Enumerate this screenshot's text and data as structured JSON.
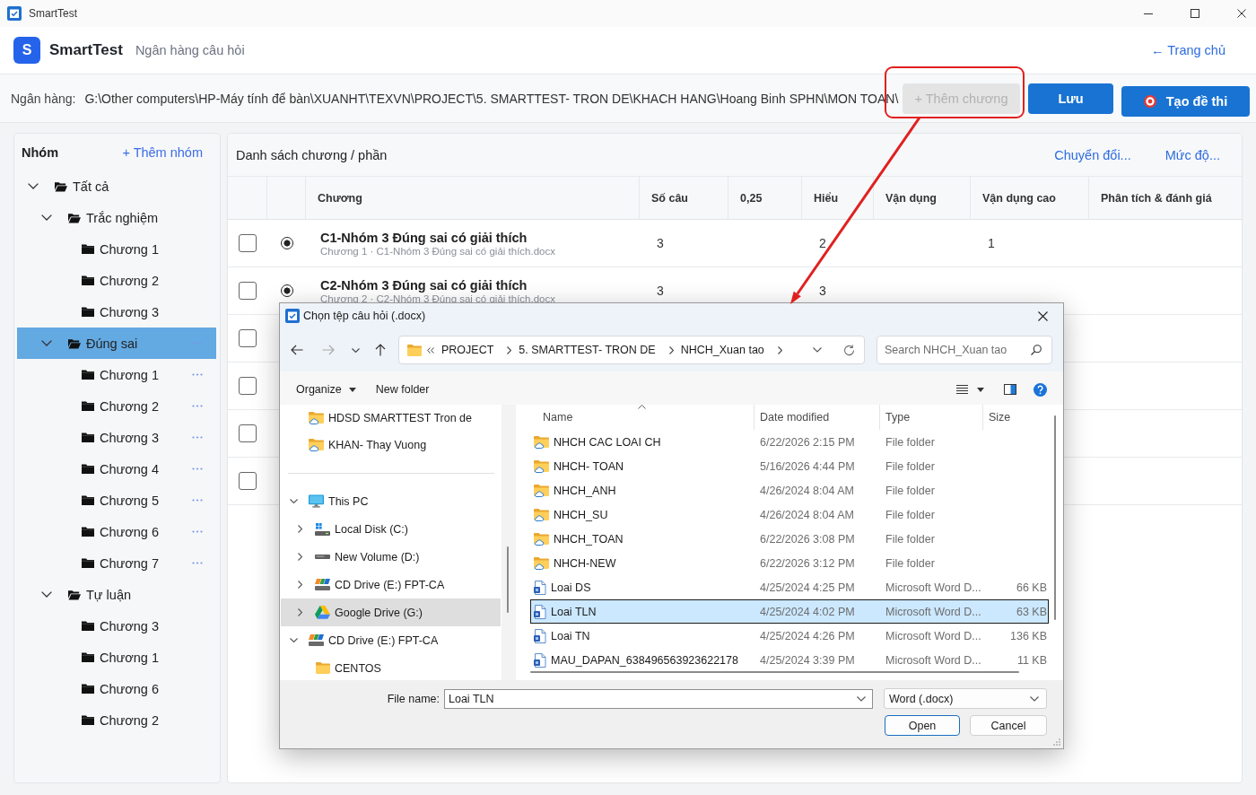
{
  "window": {
    "title": "SmartTest"
  },
  "header": {
    "logo_letter": "S",
    "app_name": "SmartTest",
    "subtitle": "Ngân hàng câu hỏi",
    "home_link": "← Trang chủ"
  },
  "bank_bar": {
    "label": "Ngân hàng:",
    "path": "G:\\Other computers\\HP-Máy tính để bàn\\XUANHT\\TEXVN\\PROJECT\\5. SMARTTEST- TRON DE\\KHACH HANG\\Hoang Binh SPHN\\MON TOAN\\",
    "buttons": [
      {
        "label": "+ Thêm chương",
        "kind": "text",
        "disabled": true
      },
      {
        "label": "Lưu",
        "kind": "text",
        "disabled": false
      },
      {
        "label": "Tạo đề thi",
        "kind": "icon",
        "disabled": false
      }
    ]
  },
  "sidebar": {
    "title": "Nhóm",
    "add_link": "+ Thêm nhóm",
    "tree": [
      {
        "label": "Tất cả",
        "kind": "group",
        "expanded": true,
        "selected": false,
        "more": false,
        "children": [
          {
            "label": "Trắc nghiệm",
            "kind": "group",
            "expanded": true,
            "selected": false,
            "more": false,
            "children": [
              {
                "label": "Chương 1",
                "kind": "chapter",
                "selected": false,
                "more": false
              },
              {
                "label": "Chương 2",
                "kind": "chapter",
                "selected": false,
                "more": false
              },
              {
                "label": "Chương 3",
                "kind": "chapter",
                "selected": false,
                "more": false
              }
            ]
          },
          {
            "label": "Đúng sai",
            "kind": "group",
            "expanded": true,
            "selected": true,
            "more": true,
            "children": [
              {
                "label": "Chương 1",
                "kind": "chapter",
                "selected": false,
                "more": true
              },
              {
                "label": "Chương 2",
                "kind": "chapter",
                "selected": false,
                "more": true
              },
              {
                "label": "Chương 3",
                "kind": "chapter",
                "selected": false,
                "more": true
              },
              {
                "label": "Chương 4",
                "kind": "chapter",
                "selected": false,
                "more": true
              },
              {
                "label": "Chương 5",
                "kind": "chapter",
                "selected": false,
                "more": true
              },
              {
                "label": "Chương 6",
                "kind": "chapter",
                "selected": false,
                "more": true
              },
              {
                "label": "Chương 7",
                "kind": "chapter",
                "selected": false,
                "more": true
              }
            ]
          },
          {
            "label": "Tự luận",
            "kind": "group",
            "expanded": true,
            "selected": false,
            "more": false,
            "children": [
              {
                "label": "Chương 3",
                "kind": "chapter",
                "selected": false,
                "more": false
              },
              {
                "label": "Chương 1",
                "kind": "chapter",
                "selected": false,
                "more": false
              },
              {
                "label": "Chương 6",
                "kind": "chapter",
                "selected": false,
                "more": false
              },
              {
                "label": "Chương 2",
                "kind": "chapter",
                "selected": false,
                "more": false
              }
            ]
          }
        ]
      }
    ]
  },
  "chapter_panel": {
    "title": "Danh sách chương / phần",
    "links": [
      "Chuyển đổi...",
      "Mức độ..."
    ],
    "table": {
      "columns": [
        "Chương",
        "Số câu",
        "0,25",
        "Hiểu",
        "Vận dụng",
        "Vận dụng cao",
        "Phân tích & đánh giá"
      ],
      "rows": [
        {
          "checked": false,
          "selected": true,
          "title": "C1-Nhóm 3 Đúng sai có giải thích",
          "source": "Chương 1 · C1-Nhóm 3 Đúng sai có giải thích.docx",
          "counts": {
            "so_cau": "3",
            "hieu": "2",
            "van_dung_cao": "1"
          }
        },
        {
          "checked": false,
          "selected": true,
          "title": "C2-Nhóm 3 Đúng sai có giải thích",
          "source": "Chương 2 · C2-Nhóm 3 Đúng sai có giải thích.docx",
          "counts": {
            "so_cau": "3",
            "hieu": "3"
          }
        },
        {
          "checked": false
        },
        {
          "checked": false
        },
        {
          "checked": false
        },
        {
          "checked": false
        }
      ]
    }
  },
  "file_dialog": {
    "title": "Chọn tệp câu hỏi (.docx)",
    "breadcrumb": [
      "PROJECT",
      "5. SMARTTEST- TRON DE",
      "NHCH_Xuan tao"
    ],
    "search": {
      "placeholder": "Search NHCH_Xuan tao"
    },
    "toolbar": {
      "organize": "Organize",
      "new_folder": "New folder"
    },
    "quick_access": [
      {
        "label": "HDSD SMARTTEST Tron de",
        "selected": false
      },
      {
        "label": "KHAN- Thay Vuong",
        "selected": false
      }
    ],
    "nav_tree": [
      {
        "label": "This PC",
        "kind": "pc",
        "expanded": true,
        "selected": false,
        "children": [
          {
            "label": "Local Disk (C:)",
            "kind": "system-disk",
            "expanded": false,
            "selected": false
          },
          {
            "label": "New Volume (D:)",
            "kind": "disk",
            "expanded": false,
            "selected": false
          },
          {
            "label": "CD Drive (E:) FPT-CA",
            "kind": "cd",
            "expanded": false,
            "selected": false
          },
          {
            "label": "Google Drive (G:)",
            "kind": "cloud-drive",
            "expanded": false,
            "selected": true
          }
        ]
      },
      {
        "label": "CD Drive (E:) FPT-CA",
        "kind": "cd",
        "expanded": true,
        "selected": false,
        "children": [
          {
            "label": "CENTOS",
            "kind": "folder",
            "selected": false
          }
        ]
      }
    ],
    "columns": [
      {
        "label": "Name",
        "sorted": true
      },
      {
        "label": "Date modified",
        "sorted": false
      },
      {
        "label": "Type",
        "sorted": false
      },
      {
        "label": "Size",
        "sorted": false
      }
    ],
    "files": [
      {
        "kind": "folder",
        "name": "NHCH CAC LOAI CH",
        "date": "6/22/2026 2:15 PM",
        "type": "File folder",
        "selected": false
      },
      {
        "kind": "folder",
        "name": "NHCH- TOAN",
        "date": "5/16/2026 4:44 PM",
        "type": "File folder",
        "selected": false
      },
      {
        "kind": "folder",
        "name": "NHCH_ANH",
        "date": "4/26/2024 8:04 AM",
        "type": "File folder",
        "selected": false
      },
      {
        "kind": "folder",
        "name": "NHCH_SU",
        "date": "4/26/2024 8:04 AM",
        "type": "File folder",
        "selected": false
      },
      {
        "kind": "folder",
        "name": "NHCH_TOAN",
        "date": "6/22/2026 3:08 PM",
        "type": "File folder",
        "selected": false
      },
      {
        "kind": "folder",
        "name": "NHCH-NEW",
        "date": "6/22/2026 3:12 PM",
        "type": "File folder",
        "selected": false
      },
      {
        "kind": "document",
        "name": "Loai DS",
        "date": "4/25/2024 4:25 PM",
        "type": "Microsoft Word D...",
        "size": "66 KB",
        "selected": false
      },
      {
        "kind": "document",
        "name": "Loai TLN",
        "date": "4/25/2024 4:02 PM",
        "type": "Microsoft Word D...",
        "size": "63 KB",
        "selected": true
      },
      {
        "kind": "document",
        "name": "Loai TN",
        "date": "4/25/2024 4:26 PM",
        "type": "Microsoft Word D...",
        "size": "136 KB",
        "selected": false
      },
      {
        "kind": "document",
        "name": "MAU_DAPAN_638496563923622178",
        "date": "4/25/2024 3:39 PM",
        "type": "Microsoft Word D...",
        "size": "11 KB",
        "selected": false
      }
    ],
    "file_name": {
      "label": "File name:",
      "value": "Loai TLN"
    },
    "file_type": "Word (.docx)",
    "buttons": [
      {
        "label": "Open",
        "kind": "default"
      },
      {
        "label": "Cancel",
        "kind": "normal"
      }
    ]
  }
}
